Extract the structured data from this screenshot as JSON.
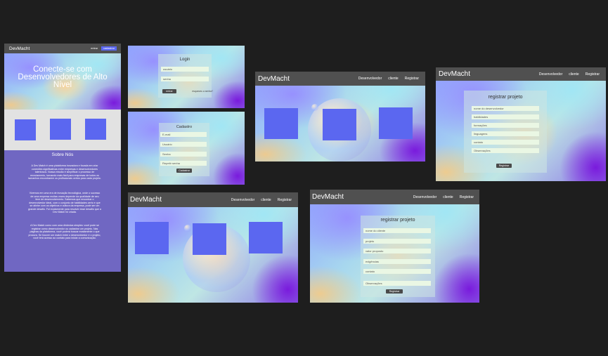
{
  "brand": "DevMacht",
  "landing": {
    "nav_login": "entrar",
    "nav_signup": "cadastrar",
    "hero_title": "Conecte-se com Desenvolvedores de Alto Nível",
    "about_title": "Sobre Nós",
    "about_paragraphs": [
      "A Dev Match é uma plataforma inovadora e focada em criar conexões significativas entre empresas e desenvolvedores talentosos. Nossa missão é simplificar o processo de recrutamento, tornando mais fácil para empresas de todos os tamanhos encontrarem os profissionais certos para cada projeto.",
      "Vivemos em uma era de inovação tecnológica, onde o sucesso de uma empresa muitas vezes depende da qualidade de seu time de desenvolvimento. Sabemos que encontrar o desenvolvedor ideal, com o conjunto de habilidades certo e que se alinhe com os objetivos e cultura da empresa, pode ser um grande desafio. Foi exatamente para resolver esse desafio que a Dev Match foi criada.",
      "A Dev Match como com uma dinâmica simples: você pode se registrar como desenvolvedor ou cadastrar um projeto. Nas páginas da plataforma, você poderá buscar exatamente o que procura. Se houver um match entre o desenvolvedor e o projeto, você terá acesso ao contato para iniciar a comunicação."
    ]
  },
  "login": {
    "title": "Login",
    "email_placeholder": "usuário",
    "password_placeholder": "senha",
    "submit": "entrar",
    "forgot": "esqueceu a senha?"
  },
  "signup": {
    "title": "Cadastro",
    "email_placeholder": "E-mail",
    "user_placeholder": "Usuário",
    "password_placeholder": "Senha",
    "repeat_placeholder": "Repetir senha",
    "submit": "Cadastrar"
  },
  "nav": {
    "developer": "Desenvolvedor",
    "client": "cliente",
    "register": "Registrar"
  },
  "dev_form": {
    "title": "registrar projeto",
    "fields": [
      "nome do desenvolvedor",
      "habilidades",
      "formações",
      "linguagens",
      "contato",
      "Observações"
    ],
    "submit": "Registrar"
  },
  "client_form": {
    "title": "registrar projeto",
    "fields": [
      "nome do cliente",
      "projeto",
      "valor proposto",
      "exigências",
      "contato",
      "Observações"
    ],
    "submit": "Registrar"
  }
}
